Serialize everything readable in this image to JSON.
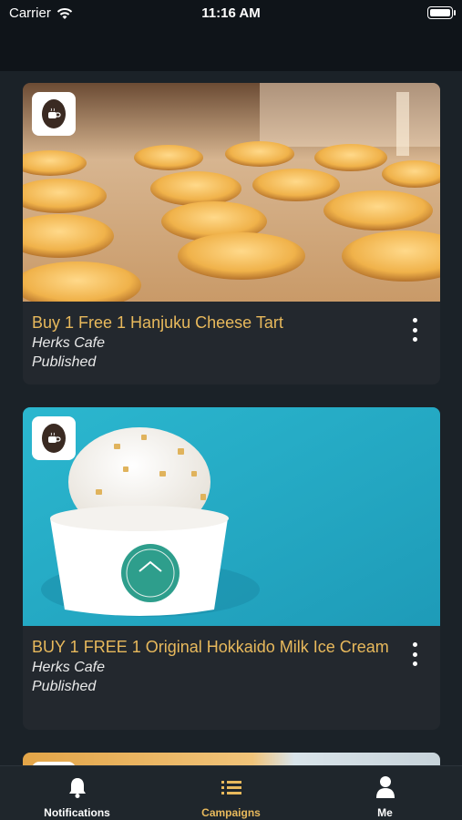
{
  "status_bar": {
    "carrier": "Carrier",
    "time": "11:16 AM",
    "icons": [
      "wifi-icon",
      "battery-icon"
    ]
  },
  "campaigns": [
    {
      "title": "Buy 1 Free 1 Hanjuku Cheese Tart",
      "merchant": "Herks Cafe",
      "status": "Published",
      "image": "cheese-tarts-photo"
    },
    {
      "title": "BUY 1 FREE 1 Original Hokkaido Milk Ice Cream",
      "merchant": "Herks Cafe",
      "status": "Published",
      "image": "hokkaido-ice-cream-photo"
    }
  ],
  "tab_bar": {
    "tabs": [
      {
        "label": "Notifications",
        "icon": "bell-icon",
        "active": false
      },
      {
        "label": "Campaigns",
        "icon": "list-icon",
        "active": true
      },
      {
        "label": "Me",
        "icon": "person-icon",
        "active": false
      }
    ]
  },
  "colors": {
    "background": "#1b2228",
    "card": "#23282e",
    "accent": "#e8b95c",
    "tab_bar": "#1f262c"
  }
}
